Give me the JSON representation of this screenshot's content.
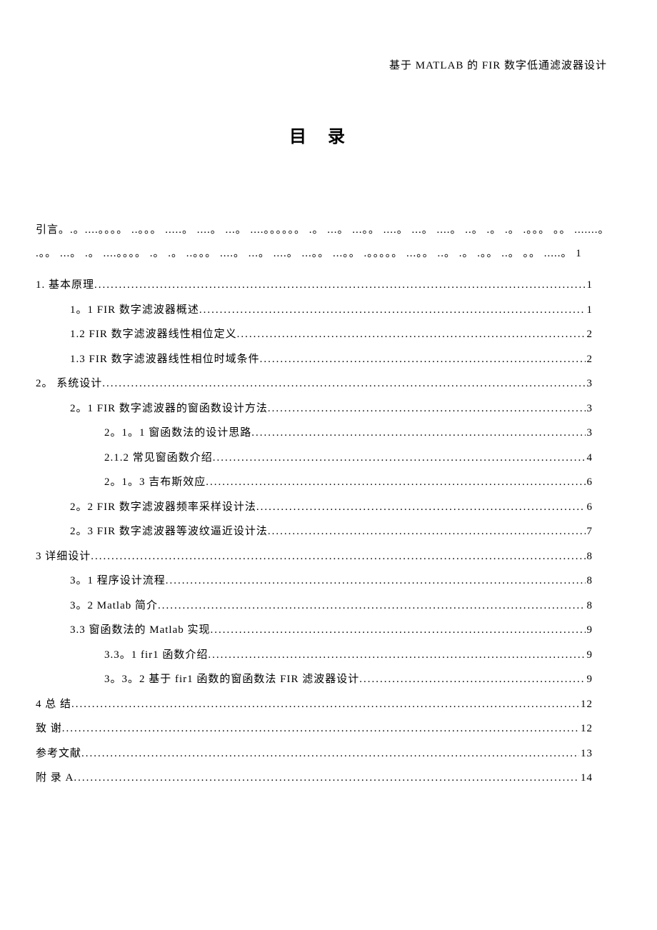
{
  "header": "基于 MATLAB 的 FIR 数字低通滤波器设计",
  "title": "目  录",
  "intro_text": "引言。.。....。。。。 ..。。。 .....。 ....。 ...。 ....。。。。。。 .。 ...。 ...。。 ....。 ...。 ....。 ..。 .。 .。 .。。。 。。 .......。 .。。 ...。 .。 ....。。。。 .。 .。 ..。。。 ....。 ...。 ....。 ...。。 ...。。 .。。。。。 ...。。 ..。 .。 .。。 ..。 。。 .....。 1",
  "toc": [
    {
      "level": 1,
      "label": "1.  基本原理 ",
      "page": "1"
    },
    {
      "level": 2,
      "label": "1。1 FIR 数字滤波器概述",
      "page": "1"
    },
    {
      "level": 2,
      "label": "1.2 FIR 数字滤波器线性相位定义 ",
      "page": "2"
    },
    {
      "level": 2,
      "label": "1.3 FIR 数字滤波器线性相位时域条件 ",
      "page": "2"
    },
    {
      "level": 1,
      "label": "2。  系统设计 ",
      "page": "3"
    },
    {
      "level": 2,
      "label": "2。1 FIR 数字滤波器的窗函数设计方法 ",
      "page": "3"
    },
    {
      "level": 3,
      "label": "2。1。1 窗函数法的设计思路",
      "page": "3"
    },
    {
      "level": 3,
      "label": "2.1.2 常见窗函数介绍 ",
      "page": "4"
    },
    {
      "level": 3,
      "label": "2。1。3 吉布斯效应 ",
      "page": "6"
    },
    {
      "level": 2,
      "label": "2。2  FIR 数字滤波器频率采样设计法 ",
      "page": "6"
    },
    {
      "level": 2,
      "label": "2。3 FIR 数字滤波器等波纹逼近设计法 ",
      "page": "7"
    },
    {
      "level": 1,
      "label": "3 详细设计 ",
      "page": "8"
    },
    {
      "level": 2,
      "label": "3。1 程序设计流程",
      "page": "8"
    },
    {
      "level": 2,
      "label": "3。2 Matlab 简介 ",
      "page": "8"
    },
    {
      "level": 2,
      "label": "3.3 窗函数法的 Matlab 实现 ",
      "page": "9"
    },
    {
      "level": 3,
      "label": "3.3。1 fir1 函数介绍",
      "page": "9"
    },
    {
      "level": 3,
      "label": "3。3。2 基于 fir1 函数的窗函数法 FIR 滤波器设计",
      "page": "9"
    },
    {
      "level": 1,
      "label": "4 总  结 ",
      "page": "12"
    },
    {
      "level": 1,
      "label": "致  谢 ",
      "page": "12"
    },
    {
      "level": 1,
      "label": "参考文献 ",
      "page": "13"
    },
    {
      "level": 1,
      "label": "附  录 A",
      "page": "14"
    }
  ]
}
